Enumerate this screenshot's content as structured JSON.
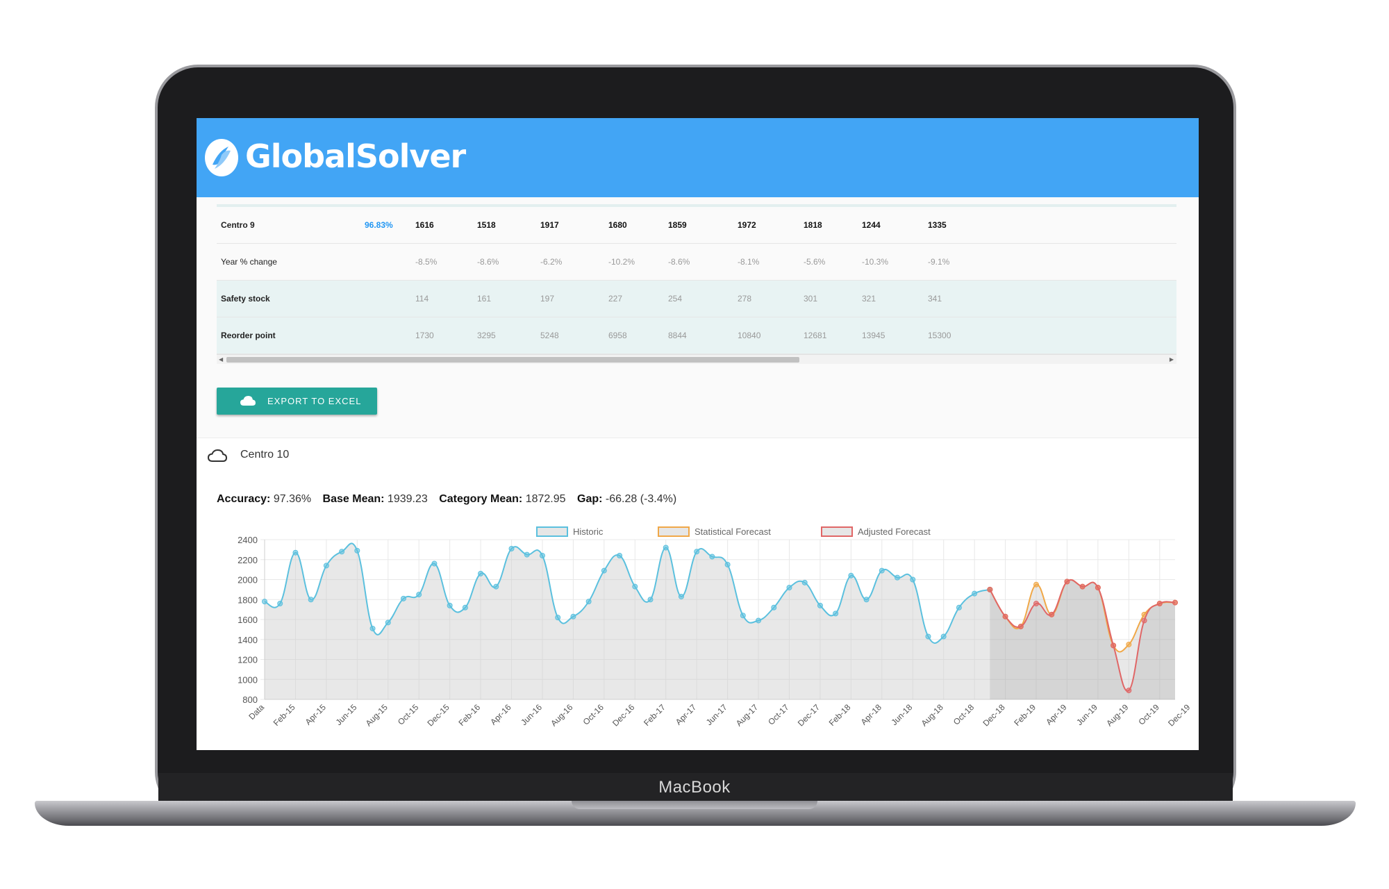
{
  "device": {
    "brand": "MacBook"
  },
  "app": {
    "name": "GlobalSolver"
  },
  "table": {
    "main_row": {
      "label": "Centro 9",
      "accuracy": "96.83%",
      "values": [
        "1616",
        "1518",
        "1917",
        "1680",
        "1859",
        "1972",
        "1818",
        "1244",
        "1335"
      ]
    },
    "rows": [
      {
        "label": "Year % change",
        "values": [
          "-8.5%",
          "-8.6%",
          "-6.2%",
          "-10.2%",
          "-8.6%",
          "-8.1%",
          "-5.6%",
          "-10.3%",
          "-9.1%"
        ]
      },
      {
        "label": "Safety stock",
        "values": [
          "114",
          "161",
          "197",
          "227",
          "254",
          "278",
          "301",
          "321",
          "341"
        ]
      },
      {
        "label": "Reorder point",
        "values": [
          "1730",
          "3295",
          "5248",
          "6958",
          "8844",
          "10840",
          "12681",
          "13945",
          "15300"
        ]
      }
    ]
  },
  "export_button": {
    "label": "EXPORT TO EXCEL",
    "icon": "cloud-icon"
  },
  "section": {
    "title": "Centro 10",
    "icon": "cloud-outline-icon"
  },
  "stats": {
    "accuracy_label": "Accuracy:",
    "accuracy": "97.36%",
    "base_mean_label": "Base Mean:",
    "base_mean": "1939.23",
    "category_mean_label": "Category Mean:",
    "category_mean": "1872.95",
    "gap_label": "Gap:",
    "gap": "-66.28",
    "gap_pct": "(-3.4%)"
  },
  "colors": {
    "header": "#42a5f5",
    "button": "#26a69a",
    "historic": "#5bc0de",
    "statistical": "#f0a848",
    "adjusted": "#e06666"
  },
  "chart_data": {
    "type": "line",
    "title": "",
    "xlabel": "",
    "ylabel": "",
    "ylim": [
      800,
      2400
    ],
    "yticks": [
      2400,
      2200,
      2000,
      1800,
      1600,
      1400,
      1200,
      1000,
      800
    ],
    "grid": true,
    "legend_position": "top",
    "x_labels": [
      "Data",
      "Feb-15",
      "Apr-15",
      "Jun-15",
      "Aug-15",
      "Oct-15",
      "Dec-15",
      "Feb-16",
      "Apr-16",
      "Jun-16",
      "Aug-16",
      "Oct-16",
      "Dec-16",
      "Feb-17",
      "Apr-17",
      "Jun-17",
      "Aug-17",
      "Oct-17",
      "Dec-17",
      "Feb-18",
      "Apr-18",
      "Jun-18",
      "Aug-18",
      "Oct-18",
      "Dec-18",
      "Feb-19",
      "Apr-19",
      "Jun-19",
      "Aug-19",
      "Oct-19",
      "Dec-19"
    ],
    "series": [
      {
        "name": "Historic",
        "start_index": 0,
        "values": [
          1780,
          1760,
          2270,
          1800,
          2140,
          2280,
          2290,
          1510,
          1570,
          1810,
          1850,
          2160,
          1740,
          1720,
          2060,
          1930,
          2310,
          2250,
          2240,
          1620,
          1630,
          1780,
          2090,
          2240,
          1930,
          1800,
          2320,
          1830,
          2280,
          2230,
          2150,
          1640,
          1590,
          1720,
          1920,
          1970,
          1740,
          1660,
          2040,
          1800,
          2090,
          2020,
          2000,
          1430,
          1430,
          1720,
          1860,
          1900
        ]
      },
      {
        "name": "Statistical Forecast",
        "start_index": 47,
        "values": [
          1900,
          1630,
          1530,
          1950,
          1650,
          1980,
          1930,
          1920,
          1340,
          1350,
          1650,
          1760,
          1770
        ]
      },
      {
        "name": "Adjusted Forecast",
        "start_index": 47,
        "values": [
          1900,
          1630,
          1530,
          1760,
          1650,
          1980,
          1930,
          1920,
          1340,
          890,
          1590,
          1760,
          1770
        ]
      }
    ]
  }
}
